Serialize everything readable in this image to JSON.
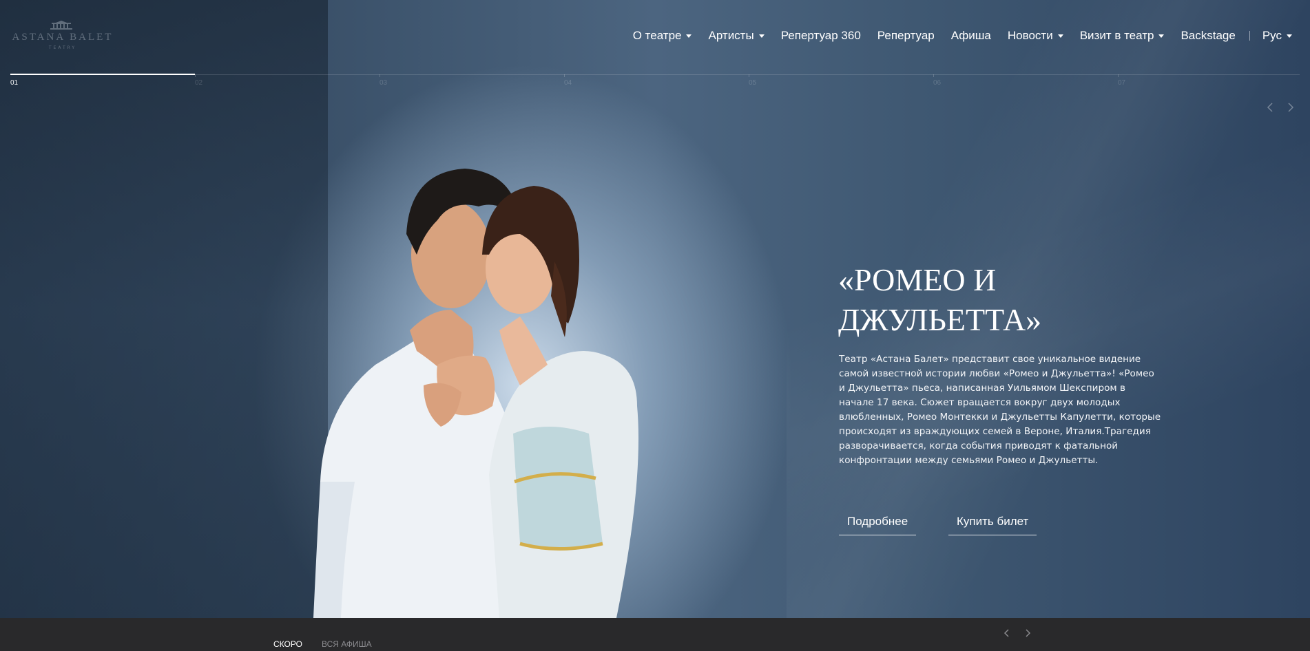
{
  "brand": {
    "name": "ASTANA BALET",
    "subtitle": "TEATRY"
  },
  "nav": {
    "items": [
      {
        "label": "О театре",
        "dropdown": true
      },
      {
        "label": "Артисты",
        "dropdown": true
      },
      {
        "label": "Репертуар 360",
        "dropdown": false
      },
      {
        "label": "Репертуар",
        "dropdown": false
      },
      {
        "label": "Афиша",
        "dropdown": false
      },
      {
        "label": "Новости",
        "dropdown": true
      },
      {
        "label": "Визит в театр",
        "dropdown": true
      },
      {
        "label": "Backstage",
        "dropdown": false
      }
    ],
    "language": "Рус"
  },
  "slider": {
    "slides": [
      "01",
      "02",
      "03",
      "04",
      "05",
      "06",
      "07"
    ],
    "current": 1,
    "prev_icon": "chevron-left-icon",
    "next_icon": "chevron-right-icon"
  },
  "hero": {
    "title": "«РОМЕО И ДЖУЛЬЕТТА»",
    "description": "Театр «Астана Балет» представит свое уникальное видение самой известной истории любви «Ромео и Джульетта»! «Ромео и Джульетта» пьеса, написанная Уильямом Шекспиром в начале 17 века. Сюжет вращается вокруг двух молодых влюбленных, Ромео Монтекки и Джульетты Капулетти, которые происходят из враждующих семей в Вероне, Италия.Трагедия разворачивается, когда события приводят к фатальной конфронтации между семьями Ромео и Джульетты.",
    "more_label": "Подробнее",
    "buy_label": "Купить билет"
  },
  "bottom": {
    "tab_soon": "СКОРО",
    "tab_all": "ВСЯ АФИША"
  },
  "colors": {
    "hero_bg": "#3e556e",
    "bottom_bar": "#29292b",
    "text": "#ffffff"
  }
}
